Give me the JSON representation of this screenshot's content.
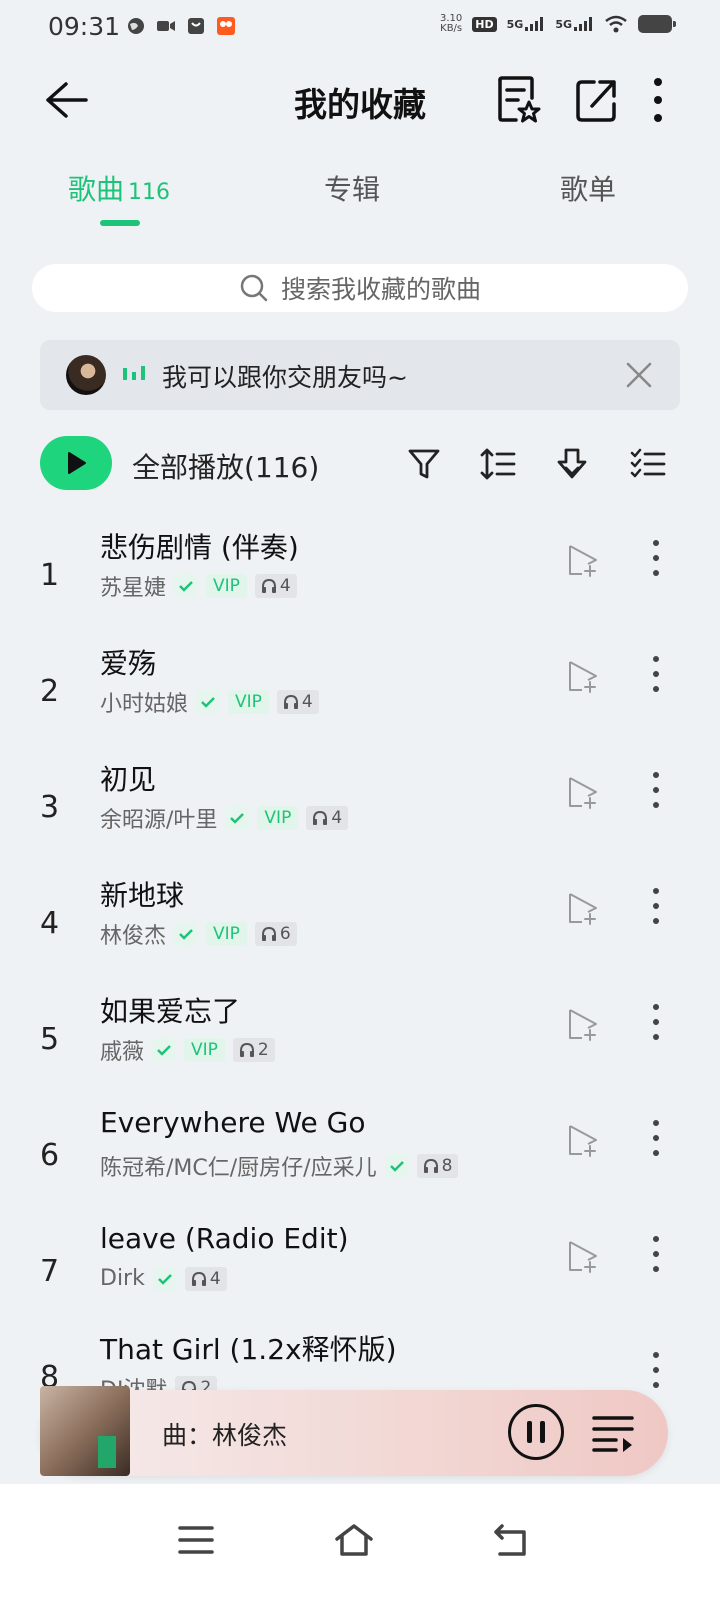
{
  "status_bar": {
    "time": "09:31",
    "net_speed_value": "3.10",
    "net_speed_unit": "KB/s",
    "hd": "HD",
    "sim_a": "5G",
    "sim_b": "5G"
  },
  "header": {
    "title": "我的收藏"
  },
  "tabs": [
    {
      "label": "歌曲",
      "count": "116"
    },
    {
      "label": "专辑"
    },
    {
      "label": "歌单"
    }
  ],
  "search": {
    "placeholder": "搜索我收藏的歌曲"
  },
  "notice": {
    "text": "我可以跟你交朋友吗~"
  },
  "actions": {
    "play_all_label": "全部播放(116)"
  },
  "songs": [
    {
      "index": "1",
      "title": "悲伤剧情 (伴奏)",
      "artist": "苏星婕",
      "vip": "VIP",
      "listens": "4"
    },
    {
      "index": "2",
      "title": "爱殇",
      "artist": "小时姑娘",
      "vip": "VIP",
      "listens": "4"
    },
    {
      "index": "3",
      "title": "初见",
      "artist": "余昭源/叶里",
      "vip": "VIP",
      "listens": "4"
    },
    {
      "index": "4",
      "title": "新地球",
      "artist": "林俊杰",
      "vip": "VIP",
      "listens": "6"
    },
    {
      "index": "5",
      "title": "如果爱忘了",
      "artist": "戚薇",
      "vip": "VIP",
      "listens": "2"
    },
    {
      "index": "6",
      "title": "Everywhere We Go",
      "artist": "陈冠希/MC仁/厨房仔/应采儿",
      "vip": "",
      "listens": "8"
    },
    {
      "index": "7",
      "title": "leave (Radio Edit)",
      "artist": "Dirk",
      "vip": "",
      "listens": "4"
    },
    {
      "index": "8",
      "title": "That Girl (1.2x释怀版)",
      "artist": "DJ沈默",
      "vip": "",
      "listens": "2"
    }
  ],
  "mini_player": {
    "title": "曲：林俊杰"
  },
  "colors": {
    "accent": "#1ec37a",
    "background": "#eff2f5"
  }
}
